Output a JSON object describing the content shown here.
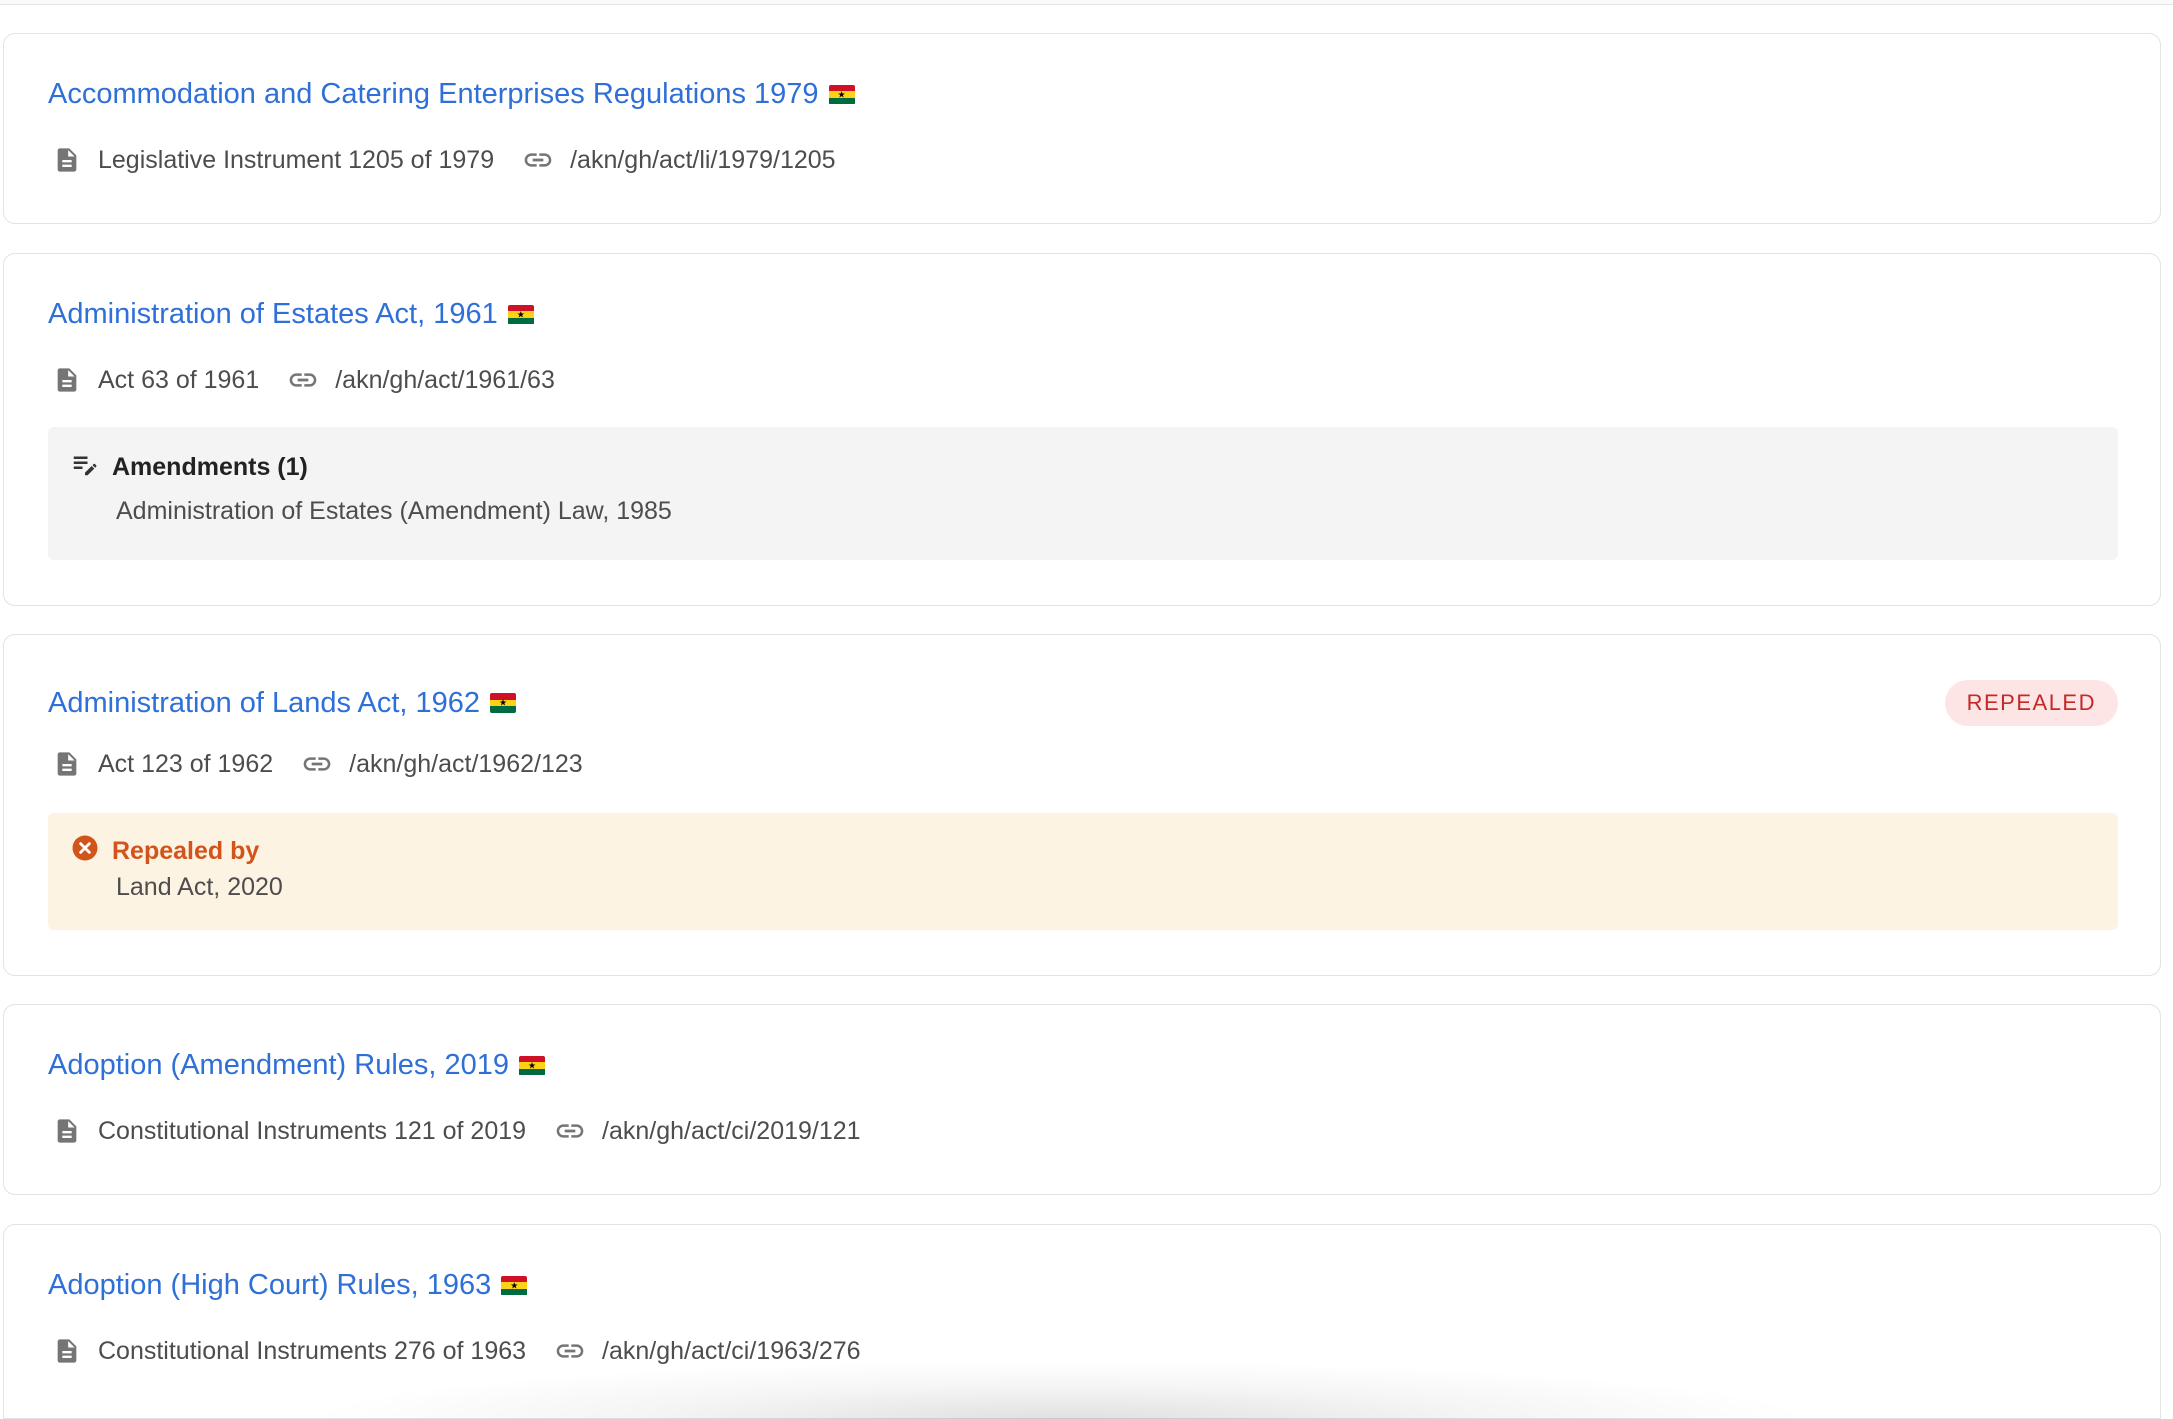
{
  "colors": {
    "link": "#2f6fd8",
    "meta_text": "#4d4d4d",
    "amend_bg": "#f4f4f4",
    "repeal_bg": "#fdf3e2",
    "repeal_accent": "#d3541b",
    "badge_bg": "#fde5e5",
    "badge_text": "#c62828"
  },
  "icons": {
    "document": "document-icon",
    "link": "link-icon",
    "amendments": "edit-notes-icon",
    "repealed": "cancel-circle-icon",
    "flag": "ghana-flag-icon"
  },
  "results": [
    {
      "title": "Accommodation and Catering Enterprises Regulations 1979",
      "citation": "Legislative Instrument 1205 of 1979",
      "frbr_uri": "/akn/gh/act/li/1979/1205"
    },
    {
      "title": "Administration of Estates Act, 1961",
      "citation": "Act 63 of 1961",
      "frbr_uri": "/akn/gh/act/1961/63",
      "amendments": {
        "heading": "Amendments (1)",
        "item": "Administration of Estates (Amendment) Law, 1985"
      }
    },
    {
      "title": "Administration of Lands Act, 1962",
      "citation": "Act 123 of 1962",
      "frbr_uri": "/akn/gh/act/1962/123",
      "badge": "REPEALED",
      "repealed": {
        "heading": "Repealed by",
        "item": "Land Act, 2020"
      }
    },
    {
      "title": "Adoption (Amendment) Rules, 2019",
      "citation": "Constitutional Instruments 121 of 2019",
      "frbr_uri": "/akn/gh/act/ci/2019/121"
    },
    {
      "title": "Adoption (High Court) Rules, 1963",
      "citation": "Constitutional Instruments 276 of 1963",
      "frbr_uri": "/akn/gh/act/ci/1963/276"
    }
  ]
}
